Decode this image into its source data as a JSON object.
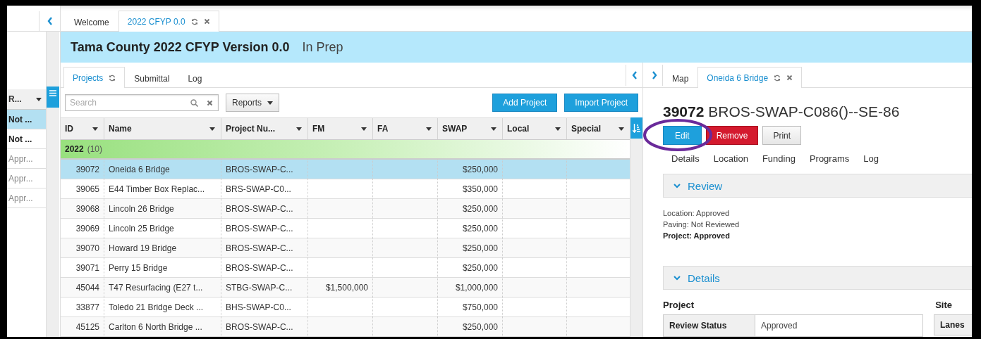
{
  "sidebar": {
    "column_header": "R...",
    "rows": [
      {
        "text": "Not ...",
        "selected": true,
        "bold": true
      },
      {
        "text": "Not ...",
        "selected": false,
        "bold": true
      },
      {
        "text": "Appr...",
        "selected": false,
        "bold": false
      },
      {
        "text": "Appr...",
        "selected": false,
        "bold": false
      },
      {
        "text": "Appr...",
        "selected": false,
        "bold": false
      }
    ]
  },
  "top_tabs": [
    {
      "label": "Welcome",
      "selected": false,
      "refreshable": false,
      "closable": false
    },
    {
      "label": "2022 CFYP 0.0",
      "selected": true,
      "refreshable": true,
      "closable": true
    }
  ],
  "title_bar": {
    "title": "Tama County 2022 CFYP Version 0.0",
    "status": "In Prep"
  },
  "projects": {
    "tabs": [
      {
        "label": "Projects",
        "selected": true,
        "refreshable": true
      },
      {
        "label": "Submittal",
        "selected": false,
        "refreshable": false
      },
      {
        "label": "Log",
        "selected": false,
        "refreshable": false
      }
    ],
    "search": {
      "placeholder": "Search"
    },
    "reports_button": "Reports",
    "buttons": [
      "Add Project",
      "Import Project"
    ],
    "table": {
      "columns": [
        "ID",
        "Name",
        "Project Nu...",
        "FM",
        "FA",
        "SWAP",
        "Local",
        "Special"
      ],
      "group": {
        "label": "2022",
        "count": "(10)"
      },
      "rows": [
        {
          "selected": true,
          "cells": [
            "39072",
            "Oneida 6 Bridge",
            "BROS-SWAP-C...",
            "",
            "",
            "$250,000",
            "",
            ""
          ]
        },
        {
          "selected": false,
          "cells": [
            "39065",
            "E44 Timber Box Replac...",
            "BRS-SWAP-C0...",
            "",
            "",
            "$350,000",
            "",
            ""
          ]
        },
        {
          "selected": false,
          "cells": [
            "39068",
            "Lincoln 26 Bridge",
            "BROS-SWAP-C...",
            "",
            "",
            "$250,000",
            "",
            ""
          ]
        },
        {
          "selected": false,
          "cells": [
            "39069",
            "Lincoln 25 Bridge",
            "BROS-SWAP-C...",
            "",
            "",
            "$250,000",
            "",
            ""
          ]
        },
        {
          "selected": false,
          "cells": [
            "39070",
            "Howard 19 Bridge",
            "BROS-SWAP-C...",
            "",
            "",
            "$250,000",
            "",
            ""
          ]
        },
        {
          "selected": false,
          "cells": [
            "39071",
            "Perry 15 Bridge",
            "BROS-SWAP-C...",
            "",
            "",
            "$250,000",
            "",
            ""
          ]
        },
        {
          "selected": false,
          "cells": [
            "45044",
            "T47 Resurfacing (E27 t...",
            "STBG-SWAP-C...",
            "$1,500,000",
            "",
            "$1,000,000",
            "",
            ""
          ]
        },
        {
          "selected": false,
          "cells": [
            "33877",
            "Toledo 21 Bridge Deck ...",
            "BHS-SWAP-C0...",
            "",
            "",
            "$750,000",
            "",
            ""
          ]
        },
        {
          "selected": false,
          "cells": [
            "45125",
            "Carlton 6 North Bridge ...",
            "BROS-SWAP-C...",
            "",
            "",
            "$250,000",
            "",
            ""
          ]
        }
      ]
    }
  },
  "detail": {
    "tabs": [
      {
        "label": "Map",
        "selected": false,
        "refreshable": false,
        "closable": false
      },
      {
        "label": "Oneida 6 Bridge",
        "selected": true,
        "refreshable": true,
        "closable": true
      }
    ],
    "heading": {
      "id": "39072",
      "title": "BROS-SWAP-C086()--SE-86"
    },
    "buttons": [
      {
        "label": "Edit",
        "kind": "primary",
        "circled": true
      },
      {
        "label": "Remove",
        "kind": "danger",
        "circled": false
      },
      {
        "label": "Print",
        "kind": "default",
        "circled": false
      }
    ],
    "sub_tabs": [
      "Details",
      "Location",
      "Funding",
      "Programs",
      "Log"
    ],
    "review": {
      "title": "Review",
      "expanded": true,
      "lines": [
        {
          "text": "Location: Approved",
          "bold": false
        },
        {
          "text": "Paving: Not Reviewed",
          "bold": false
        },
        {
          "text": "Project: Approved",
          "bold": true
        }
      ]
    },
    "details": {
      "title": "Details",
      "expanded": true,
      "project_heading": "Project",
      "site_heading": "Site",
      "fields": [
        {
          "label": "Review Status",
          "value": "Approved"
        }
      ],
      "site_fields": [
        "Lanes"
      ]
    }
  }
}
